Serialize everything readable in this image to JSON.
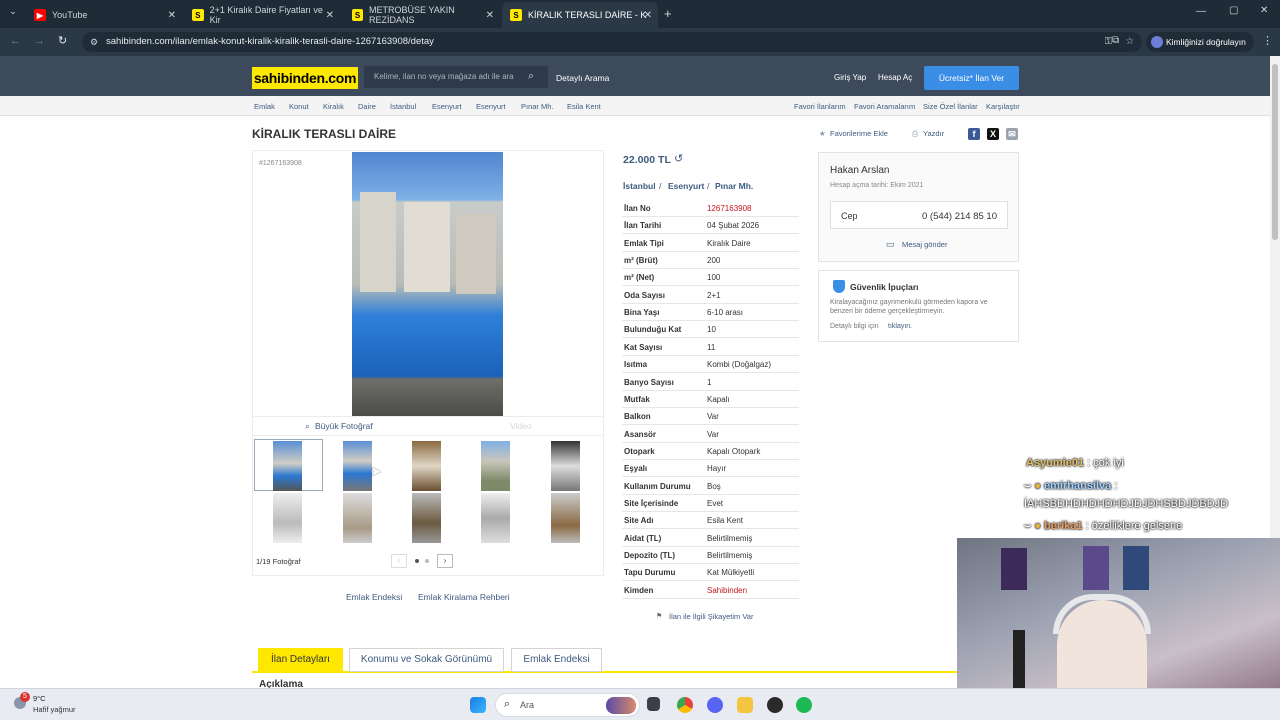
{
  "browser": {
    "tabs": [
      {
        "label": "YouTube",
        "icon": "youtube-icon"
      },
      {
        "label": "2+1 Kiralık Daire Fiyatları ve Kir",
        "icon": "sahibinden-icon"
      },
      {
        "label": "METROBÜSE YAKIN REZİDANS",
        "icon": "sahibinden-icon"
      },
      {
        "label": "KİRALIK TERASLI DAİRE - Kiralık",
        "icon": "sahibinden-icon"
      }
    ],
    "url": "sahibinden.com/ilan/emlak-konut-kiralik-kiralik-terasli-daire-1267163908/detay",
    "verify_label": "Kimliğinizi doğrulayın"
  },
  "header": {
    "logo": "sahibinden.com",
    "search_placeholder": "Kelime, ilan no veya mağaza adı ile ara",
    "advanced_search": "Detaylı Arama",
    "login": "Giriş Yap",
    "register": "Hesap Aç",
    "post_ad": "Ücretsiz* İlan Ver"
  },
  "breadcrumb": [
    "Emlak",
    "Konut",
    "Kiralık",
    "Daire",
    "İstanbul",
    "Esenyurt",
    "Esenyurt",
    "Pınar Mh.",
    "Esila Kent"
  ],
  "quick_links": [
    "Favori İlanlarım",
    "Favori Aramalarım",
    "Size Özel İlanlar",
    "Karşılaştır"
  ],
  "listing": {
    "title": "KİRALIK TERASLI DAİRE",
    "favorite": "Favorilerime Ekle",
    "print": "Yazdır",
    "ad_ref": "#1267163908",
    "price": "22.000 TL",
    "location": [
      "İstanbul",
      "Esenyurt",
      "Pınar Mh."
    ],
    "large_photo": "Büyük Fotoğraf",
    "video": "Video",
    "photo_count": "1/19 Fotoğraf",
    "links": [
      "Emlak Endeksi",
      "Emlak Kiralama Rehberi"
    ],
    "complaint": "İlan ile İlgili Şikayetim Var"
  },
  "details": [
    {
      "k": "İlan No",
      "v": "1267163908",
      "red": true
    },
    {
      "k": "İlan Tarihi",
      "v": "04 Şubat 2026"
    },
    {
      "k": "Emlak Tipi",
      "v": "Kiralık Daire"
    },
    {
      "k": "m² (Brüt)",
      "v": "200"
    },
    {
      "k": "m² (Net)",
      "v": "100"
    },
    {
      "k": "Oda Sayısı",
      "v": "2+1"
    },
    {
      "k": "Bina Yaşı",
      "v": "6-10 arası"
    },
    {
      "k": "Bulunduğu Kat",
      "v": "10"
    },
    {
      "k": "Kat Sayısı",
      "v": "11"
    },
    {
      "k": "Isıtma",
      "v": "Kombi (Doğalgaz)"
    },
    {
      "k": "Banyo Sayısı",
      "v": "1"
    },
    {
      "k": "Mutfak",
      "v": "Kapalı"
    },
    {
      "k": "Balkon",
      "v": "Var"
    },
    {
      "k": "Asansör",
      "v": "Var"
    },
    {
      "k": "Otopark",
      "v": "Kapalı Otopark"
    },
    {
      "k": "Eşyalı",
      "v": "Hayır"
    },
    {
      "k": "Kullanım Durumu",
      "v": "Boş"
    },
    {
      "k": "Site İçerisinde",
      "v": "Evet"
    },
    {
      "k": "Site Adı",
      "v": "Esila Kent"
    },
    {
      "k": "Aidat (TL)",
      "v": "Belirtilmemiş"
    },
    {
      "k": "Depozito (TL)",
      "v": "Belirtilmemiş"
    },
    {
      "k": "Tapu Durumu",
      "v": "Kat Mülkiyetli"
    },
    {
      "k": "Kimden",
      "v": "Sahibinden",
      "red": true
    }
  ],
  "seller": {
    "name": "Hakan Arslan",
    "since": "Hesap açma tarihi: Ekim 2021",
    "phone_label": "Cep",
    "phone": "0 (544) 214 85 10",
    "message": "Mesaj gönder"
  },
  "safety": {
    "title": "Güvenlik İpuçları",
    "text": "Kiralayacağınız gayrimenkulü görmeden kapora ve benzeri bir ödeme gerçekleştirmeyin.",
    "more_prefix": "Detaylı bilgi için",
    "more_link": "tıklayın."
  },
  "bottom_tabs": [
    "İlan Detayları",
    "Konumu ve Sokak Görünümü",
    "Emlak Endeksi"
  ],
  "description_heading": "Açıklama",
  "stream_chat": [
    {
      "user": "Asyumie01",
      "msg": ": çok iyi"
    },
    {
      "user": "emirhansilva",
      "msg": ":"
    },
    {
      "user": "",
      "msg": "İAHSBDHDHDHDHDJDJDHSBDJDBDJD"
    },
    {
      "user": "berika1",
      "msg": ": özelliklere gelsene"
    }
  ],
  "taskbar": {
    "weather_temp": "9°C",
    "weather_desc": "Hafif yağmur",
    "search": "Ara",
    "badge": "5"
  },
  "colors": {
    "brand_yellow": "#ffe800",
    "header": "#3d4a5c",
    "link": "#3d5a80",
    "red": "#c4161c",
    "post_button": "#3a8ee6"
  }
}
